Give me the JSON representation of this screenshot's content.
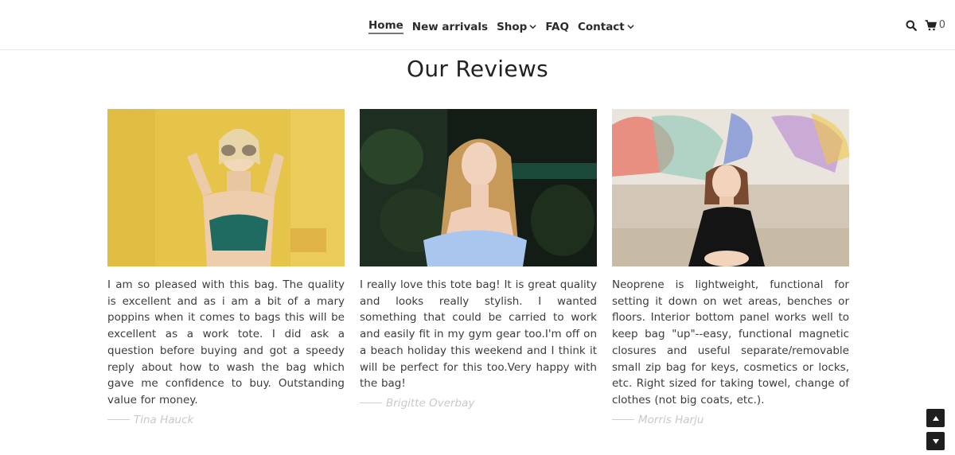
{
  "nav": {
    "items": [
      {
        "label": "Home",
        "active": true,
        "dropdown": false
      },
      {
        "label": "New arrivals",
        "active": false,
        "dropdown": false
      },
      {
        "label": "Shop",
        "active": false,
        "dropdown": true
      },
      {
        "label": "FAQ",
        "active": false,
        "dropdown": false
      },
      {
        "label": "Contact",
        "active": false,
        "dropdown": true
      }
    ],
    "search_icon": "search-icon",
    "cart_icon": "cart-icon",
    "cart_count": "0"
  },
  "page": {
    "title": "Our Reviews"
  },
  "reviews": [
    {
      "text": "I am so pleased with this bag. The quality is excellent and as i am a bit of a mary poppins when it comes to bags this will be excellent as a work tote. I did ask a question before buying and got a speedy reply about how to wash the bag which gave me confidence to buy. Outstanding value for money.",
      "author": "Tina Hauck",
      "photo_bg": "#e8c64a"
    },
    {
      "text": "I really love this tote bag! It is great quality and looks really stylish. I wanted something that could be carried to work and easily fit in my gym gear too.I'm off on a beach holiday this weekend and I think it will be perfect for this too.Very happy with the bag!",
      "author": "Brigitte Overbay",
      "photo_bg": "#18221b"
    },
    {
      "text": "Neoprene is lightweight, functional for setting it down on wet areas, benches or floors. Interior bottom panel works well to keep bag \"up\"--easy, functional magnetic closures and useful separate/removable small zip bag for keys, cosmetics or locks, etc. Right sized for taking towel, change of clothes (not big coats, etc.).",
      "author": "Morris Harju",
      "photo_bg": "#d9d3c8"
    }
  ],
  "controls": {
    "scroll_up_icon": "arrow-up-icon",
    "scroll_down_icon": "arrow-down-icon"
  }
}
